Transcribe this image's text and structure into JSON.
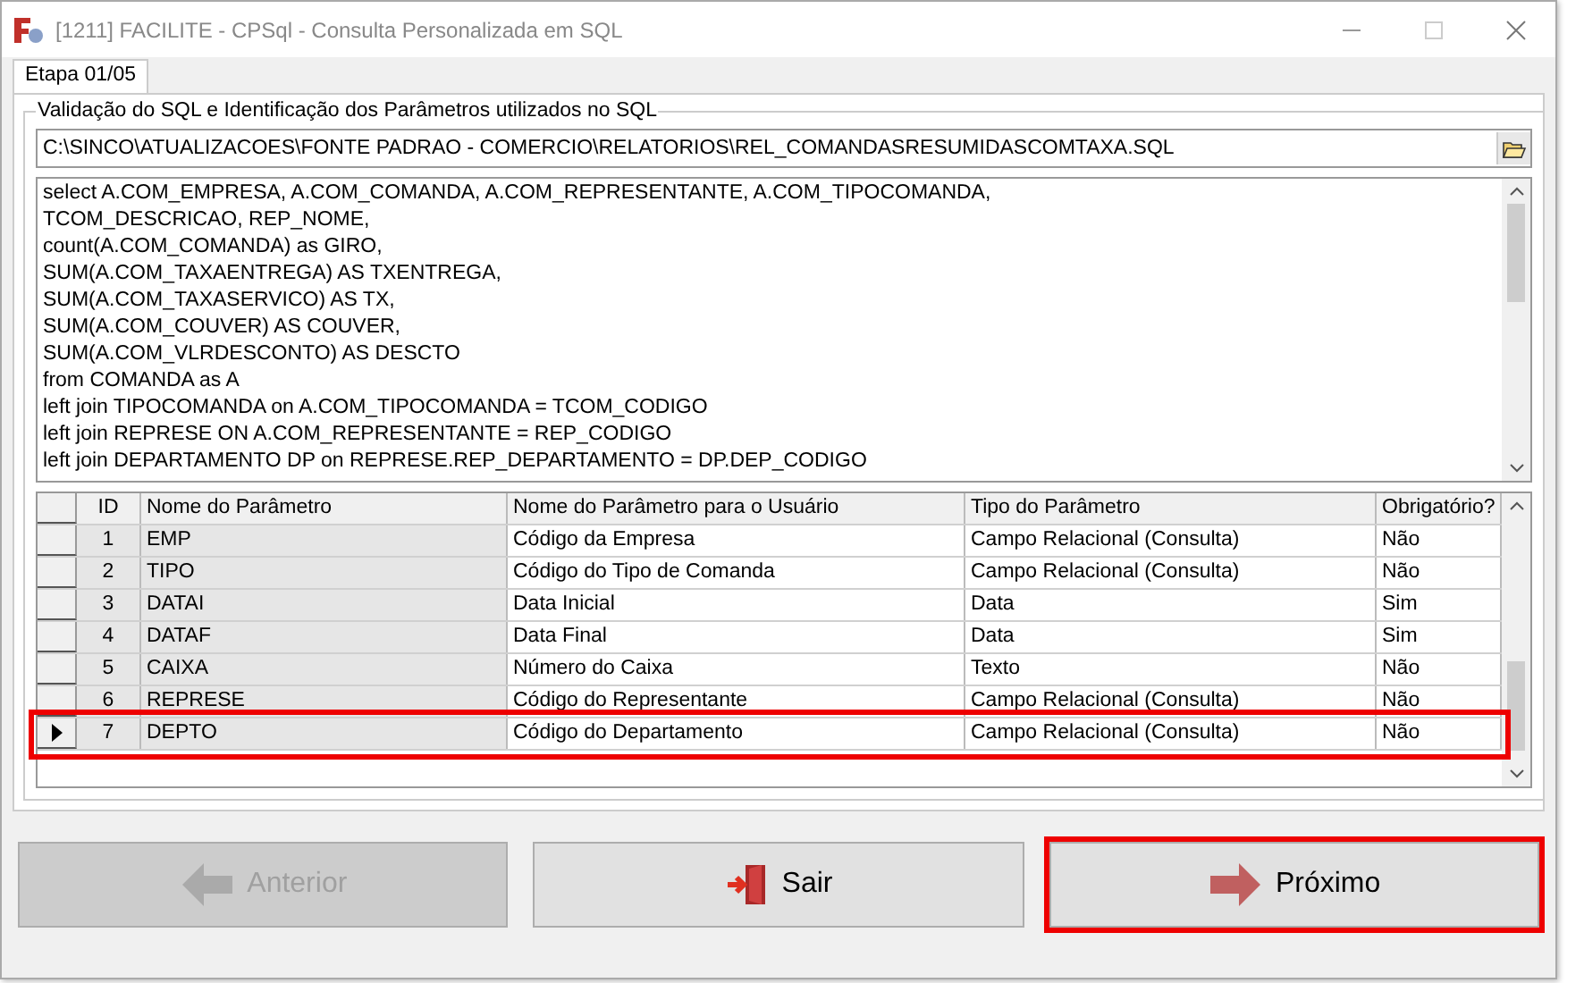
{
  "window": {
    "title": "[1211] FACILITE - CPSql - Consulta Personalizada em SQL"
  },
  "tabs": [
    {
      "label": "Etapa 01/05",
      "selected": true
    }
  ],
  "group": {
    "title": "Validação do SQL e Identificação dos Parâmetros utilizados no SQL"
  },
  "path_field": {
    "value": "C:\\SINCO\\ATUALIZACOES\\FONTE PADRAO - COMERCIO\\RELATORIOS\\REL_COMANDASRESUMIDASCOMTAXA.SQL"
  },
  "sql_lines": [
    "select A.COM_EMPRESA, A.COM_COMANDA, A.COM_REPRESENTANTE, A.COM_TIPOCOMANDA,",
    "TCOM_DESCRICAO, REP_NOME,",
    "count(A.COM_COMANDA) as GIRO,",
    "SUM(A.COM_TAXAENTREGA) AS TXENTREGA,",
    "SUM(A.COM_TAXASERVICO) AS TX,",
    "SUM(A.COM_COUVER) AS COUVER,",
    "SUM(A.COM_VLRDESCONTO) AS DESCTO",
    "from COMANDA as A",
    "left join TIPOCOMANDA on A.COM_TIPOCOMANDA = TCOM_CODIGO",
    "left join REPRESE ON A.COM_REPRESENTANTE = REP_CODIGO",
    "left join DEPARTAMENTO DP on REPRESE.REP_DEPARTAMENTO = DP.DEP_CODIGO"
  ],
  "table": {
    "columns": [
      "ID",
      "Nome do Parâmetro",
      "Nome do Parâmetro para o Usuário",
      "Tipo do Parâmetro",
      "Obrigatório?"
    ],
    "rows": [
      {
        "cells": [
          "1",
          "EMP",
          "Código da Empresa",
          "Campo Relacional (Consulta)",
          "Não"
        ],
        "selected": false,
        "highlighted": false
      },
      {
        "cells": [
          "2",
          "TIPO",
          "Código do Tipo de Comanda",
          "Campo Relacional (Consulta)",
          "Não"
        ],
        "selected": false,
        "highlighted": false
      },
      {
        "cells": [
          "3",
          "DATAI",
          "Data Inicial",
          "Data",
          "Sim"
        ],
        "selected": false,
        "highlighted": false
      },
      {
        "cells": [
          "4",
          "DATAF",
          "Data Final",
          "Data",
          "Sim"
        ],
        "selected": false,
        "highlighted": false
      },
      {
        "cells": [
          "5",
          "CAIXA",
          "Número do Caixa",
          "Texto",
          "Não"
        ],
        "selected": false,
        "highlighted": false
      },
      {
        "cells": [
          "6",
          "REPRESE",
          "Código do Representante",
          "Campo Relacional (Consulta)",
          "Não"
        ],
        "selected": false,
        "highlighted": false
      },
      {
        "cells": [
          "7",
          "DEPTO",
          "Código do Departamento",
          "Campo Relacional (Consulta)",
          "Não"
        ],
        "selected": true,
        "highlighted": true
      }
    ]
  },
  "buttons": [
    {
      "label": "Anterior",
      "kind": "back",
      "disabled": true,
      "highlighted": false
    },
    {
      "label": "Sair",
      "kind": "exit",
      "disabled": false,
      "highlighted": false
    },
    {
      "label": "Próximo",
      "kind": "next",
      "disabled": false,
      "highlighted": true
    }
  ]
}
